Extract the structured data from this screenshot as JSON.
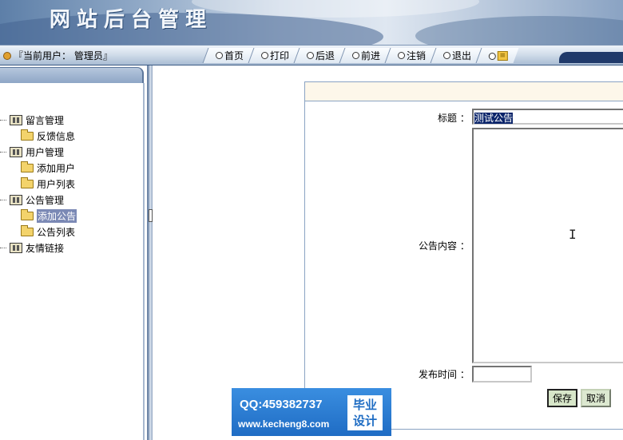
{
  "header": {
    "title": "网站后台管理"
  },
  "toolbar": {
    "user_info": "『当前用户： 管理员』",
    "nav": [
      {
        "label": "首页",
        "icon": "circle-icon"
      },
      {
        "label": "打印",
        "icon": "circle-icon"
      },
      {
        "label": "后退",
        "icon": "circle-icon"
      },
      {
        "label": "前进",
        "icon": "circle-icon"
      },
      {
        "label": "注销",
        "icon": "circle-icon"
      },
      {
        "label": "退出",
        "icon": "circle-icon"
      },
      {
        "label": "",
        "icon": "help-icon"
      }
    ]
  },
  "sidebar": {
    "tree": [
      {
        "label": "留言管理",
        "level": 1,
        "icon": "book-icon"
      },
      {
        "label": "反馈信息",
        "level": 2,
        "icon": "folder-icon"
      },
      {
        "label": "用户管理",
        "level": 1,
        "icon": "book-icon"
      },
      {
        "label": "添加用户",
        "level": 2,
        "icon": "folder-icon"
      },
      {
        "label": "用户列表",
        "level": 2,
        "icon": "folder-icon"
      },
      {
        "label": "公告管理",
        "level": 1,
        "icon": "book-icon"
      },
      {
        "label": "添加公告",
        "level": 2,
        "icon": "folder-icon",
        "selected": true
      },
      {
        "label": "公告列表",
        "level": 2,
        "icon": "folder-icon"
      },
      {
        "label": "友情链接",
        "level": 1,
        "icon": "book-icon"
      }
    ]
  },
  "form": {
    "title_label": "标题 ：",
    "title_value": "测试公告",
    "content_label": "公告内容 ：",
    "content_value": "",
    "time_label": "发布时间 ：",
    "time_value": "",
    "save_label": "保存",
    "cancel_label": "取消"
  },
  "watermark": {
    "qq": "QQ:459382737",
    "url": "www.kecheng8.com",
    "badge_line1": "毕业",
    "badge_line2": "设计"
  },
  "colors": {
    "selected_bg": "#7b89b5",
    "button_bg": "#d7e6c9",
    "watermark_bg": "#1f6cc4"
  }
}
